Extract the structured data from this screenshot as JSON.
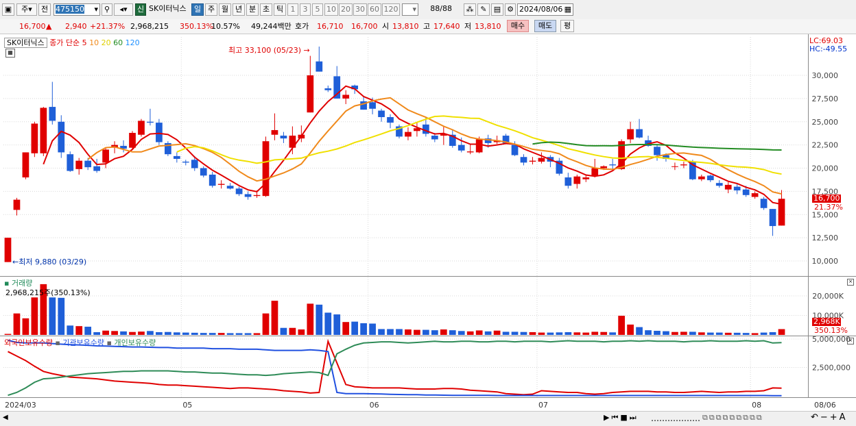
{
  "toolbar": {
    "period": "주",
    "jeon": "전",
    "code": "475150",
    "sin_badge": "신",
    "stock_name": "SK이터닉스",
    "tabs": [
      "일",
      "주",
      "월",
      "년",
      "분",
      "초",
      "틱"
    ],
    "selected_tab": "일",
    "intervals": [
      "1",
      "3",
      "5",
      "10",
      "20",
      "30",
      "60",
      "120"
    ],
    "page_count": "88/88",
    "date": "2024/08/06"
  },
  "quote": {
    "price": "16,700",
    "change": "2,940",
    "change_pct": "+21.37%",
    "volume": "2,968,215",
    "vol_ratio": "350.13%",
    "turnover": "10.57%",
    "amount": "49,244백만",
    "hoga_label": "호가",
    "hoga_1": "16,710",
    "hoga_2": "16,700",
    "open_label": "시",
    "open": "13,810",
    "high_label": "고",
    "high": "17,640",
    "low_label": "저",
    "low": "13,810",
    "buy_button": "매수",
    "sell_button": "매도",
    "eval_button": "평"
  },
  "price_panel": {
    "legend_name": "SK이터닉스",
    "legend_ma_label": "종가 단순",
    "ma_periods": [
      "5",
      "10",
      "20",
      "60",
      "120"
    ],
    "ma_colors": [
      "#e00000",
      "#f08a1c",
      "#f0e000",
      "#228b22",
      "#1e90ff"
    ],
    "lc": "LC:69.03",
    "hc": "HC:-49.55",
    "high_annotation": "최고 33,100 (05/23)",
    "low_annotation": "최저 9,880 (03/29)",
    "last_price_tag": "16,700",
    "last_pct_tag": "21.37%"
  },
  "volume_panel": {
    "title": "거래량",
    "value_text": "2,968,215주(350.13%)",
    "last_tag": "2,968K",
    "last_pct_tag": "350.13%"
  },
  "holdings_panel": {
    "legend": [
      "외국인보유수량",
      "기관보유수량",
      "개인보유수량"
    ],
    "colors": [
      "#e00000",
      "#2050e0",
      "#2e8b57"
    ]
  },
  "chart_data": [
    {
      "type": "candlestick",
      "title": "SK이터닉스",
      "y_ticks": [
        "10,000",
        "12,500",
        "15,000",
        "17,500",
        "20,000",
        "22,500",
        "25,000",
        "27,500",
        "30,000"
      ],
      "ylim": [
        8500,
        33500
      ],
      "x_labels": [
        "2024/03",
        "05",
        "06",
        "07",
        "08",
        "08/06"
      ],
      "ohlc": [
        [
          9880,
          12500,
          9880,
          12500
        ],
        [
          15500,
          16800,
          14900,
          16600
        ],
        [
          19000,
          21700,
          18800,
          21700
        ],
        [
          21600,
          25000,
          21200,
          24800
        ],
        [
          21600,
          26600,
          21300,
          26500
        ],
        [
          26600,
          29300,
          24700,
          25100
        ],
        [
          25000,
          25700,
          21100,
          21700
        ],
        [
          21500,
          21800,
          19600,
          19700
        ],
        [
          19900,
          21100,
          19300,
          20800
        ],
        [
          20800,
          21100,
          19800,
          20100
        ],
        [
          20200,
          21000,
          19500,
          19700
        ],
        [
          20600,
          22200,
          20000,
          22000
        ],
        [
          22200,
          22900,
          21600,
          22500
        ],
        [
          22400,
          23000,
          21700,
          22100
        ],
        [
          22200,
          24000,
          22000,
          23800
        ],
        [
          23600,
          25300,
          23400,
          25100
        ],
        [
          25000,
          26400,
          24600,
          24900
        ],
        [
          24900,
          25300,
          22500,
          22800
        ],
        [
          22700,
          22900,
          21300,
          21500
        ],
        [
          21300,
          21700,
          20600,
          21000
        ],
        [
          20700,
          20900,
          20300,
          20600
        ],
        [
          20900,
          21300,
          19700,
          20000
        ],
        [
          20000,
          20200,
          19000,
          19200
        ],
        [
          19300,
          19600,
          17900,
          18100
        ],
        [
          18200,
          18700,
          17800,
          18300
        ],
        [
          18100,
          18400,
          17700,
          17800
        ],
        [
          17800,
          18000,
          17000,
          17200
        ],
        [
          17200,
          17500,
          16600,
          16900
        ],
        [
          17000,
          17600,
          16800,
          17100
        ],
        [
          17000,
          23400,
          16900,
          22900
        ],
        [
          23600,
          25900,
          23000,
          24100
        ],
        [
          23500,
          23900,
          22700,
          23200
        ],
        [
          22200,
          24500,
          21500,
          23500
        ],
        [
          23200,
          24600,
          22800,
          23600
        ],
        [
          26000,
          32100,
          26000,
          30000
        ],
        [
          31500,
          33100,
          30400,
          30400
        ],
        [
          28600,
          28900,
          28200,
          28400
        ],
        [
          29900,
          31000,
          27500,
          27500
        ],
        [
          27500,
          28400,
          26900,
          27900
        ],
        [
          28900,
          29000,
          28000,
          28500
        ],
        [
          27200,
          27800,
          26300,
          26300
        ],
        [
          27100,
          27600,
          25800,
          26400
        ],
        [
          26200,
          26400,
          25000,
          25500
        ],
        [
          25500,
          25800,
          24300,
          24900
        ],
        [
          24500,
          24700,
          23200,
          23400
        ],
        [
          23400,
          24400,
          23000,
          23900
        ],
        [
          24000,
          24900,
          23400,
          24300
        ],
        [
          24700,
          25500,
          23400,
          23700
        ],
        [
          23500,
          23800,
          22800,
          23100
        ],
        [
          23500,
          24500,
          22500,
          23700
        ],
        [
          23600,
          24200,
          22200,
          22400
        ],
        [
          22500,
          23300,
          21700,
          21900
        ],
        [
          21700,
          22600,
          21500,
          21800
        ],
        [
          21700,
          23400,
          21600,
          23100
        ],
        [
          23200,
          23600,
          22200,
          22700
        ],
        [
          22800,
          23500,
          22600,
          23000
        ],
        [
          23500,
          23700,
          22600,
          22700
        ],
        [
          22500,
          22900,
          21300,
          21400
        ],
        [
          21200,
          21500,
          20300,
          20600
        ],
        [
          20700,
          21200,
          20400,
          20800
        ],
        [
          20700,
          21700,
          20500,
          21100
        ],
        [
          21200,
          21400,
          20100,
          20700
        ],
        [
          20800,
          21100,
          19200,
          19400
        ],
        [
          19000,
          19500,
          17800,
          18100
        ],
        [
          18300,
          19300,
          17800,
          19100
        ],
        [
          18800,
          19300,
          18500,
          19000
        ],
        [
          19200,
          21000,
          19000,
          20000
        ],
        [
          20000,
          20300,
          19800,
          20200
        ],
        [
          20400,
          21000,
          19800,
          20300
        ],
        [
          19900,
          23100,
          19800,
          22900
        ],
        [
          23100,
          25000,
          22700,
          24200
        ],
        [
          24200,
          25300,
          23200,
          23300
        ],
        [
          23000,
          23500,
          22300,
          22400
        ],
        [
          22300,
          22600,
          20800,
          21400
        ],
        [
          21400,
          21600,
          20700,
          21000
        ],
        [
          20200,
          20600,
          19800,
          20200
        ],
        [
          20300,
          20700,
          20000,
          20400
        ],
        [
          20700,
          20900,
          18700,
          18800
        ],
        [
          18800,
          19300,
          18600,
          19100
        ],
        [
          19200,
          19300,
          18500,
          18700
        ],
        [
          18400,
          18700,
          17900,
          18100
        ],
        [
          17700,
          18500,
          17300,
          18200
        ],
        [
          18000,
          18300,
          17200,
          17600
        ],
        [
          17700,
          18100,
          16900,
          17100
        ],
        [
          16900,
          17500,
          16700,
          17300
        ],
        [
          16700,
          16900,
          15500,
          15700
        ],
        [
          15600,
          15600,
          12700,
          13760
        ],
        [
          13810,
          17640,
          13810,
          16700
        ]
      ],
      "volume_k": [
        520,
        11000,
        8500,
        19200,
        26000,
        19200,
        19000,
        4800,
        4500,
        4200,
        1400,
        2200,
        2000,
        1800,
        1500,
        1700,
        2000,
        1400,
        1500,
        1300,
        1200,
        1100,
        1000,
        1000,
        1000,
        900,
        900,
        900,
        900,
        11000,
        17500,
        3600,
        3600,
        2800,
        16000,
        15500,
        11400,
        10500,
        6600,
        6800,
        6000,
        5800,
        3000,
        3000,
        3000,
        2800,
        2600,
        2600,
        2400,
        2800,
        2400,
        2000,
        1800,
        2300,
        1800,
        2200,
        1600,
        1600,
        1500,
        1400,
        1200,
        1200,
        1300,
        1400,
        1300,
        1200,
        1600,
        1500,
        1300,
        9800,
        5300,
        4000,
        2400,
        2100,
        1900,
        1500,
        1600,
        1600,
        1300,
        1200,
        1200,
        1100,
        1100,
        1000,
        900,
        1200,
        1400,
        2968
      ],
      "holdings": {
        "x_ticks": [
          "5,000,000",
          "2,500,000"
        ],
        "foreign": [
          3900000,
          3500000,
          3100000,
          2600000,
          2150000,
          1950000,
          1800000,
          1650000,
          1600000,
          1550000,
          1500000,
          1400000,
          1300000,
          1250000,
          1200000,
          1150000,
          1100000,
          1000000,
          950000,
          950000,
          900000,
          850000,
          800000,
          750000,
          700000,
          650000,
          700000,
          700000,
          650000,
          600000,
          550000,
          450000,
          400000,
          350000,
          250000,
          300000,
          4800000,
          2900000,
          1000000,
          800000,
          750000,
          700000,
          700000,
          700000,
          700000,
          650000,
          600000,
          600000,
          600000,
          650000,
          650000,
          600000,
          500000,
          450000,
          400000,
          350000,
          200000,
          150000,
          100000,
          150000,
          450000,
          400000,
          350000,
          300000,
          300000,
          200000,
          150000,
          200000,
          300000,
          350000,
          400000,
          400000,
          400000,
          350000,
          350000,
          300000,
          300000,
          350000,
          400000,
          350000,
          300000,
          350000,
          350000,
          400000,
          400000,
          450000,
          700000,
          680000
        ],
        "institution": [
          4900000,
          4700000,
          4650000,
          4650000,
          4650000,
          4600000,
          4550000,
          4500000,
          4480000,
          4450000,
          4400000,
          4380000,
          4350000,
          4330000,
          4300000,
          4300000,
          4280000,
          4250000,
          4250000,
          4200000,
          4200000,
          4200000,
          4200000,
          4150000,
          4150000,
          4150000,
          4100000,
          4100000,
          4100000,
          4050000,
          4000000,
          4000000,
          4000000,
          4000000,
          4050000,
          4000000,
          3900000,
          300000,
          200000,
          200000,
          200000,
          180000,
          160000,
          140000,
          120000,
          100000,
          100000,
          80000,
          80000,
          60000,
          50000,
          50000,
          50000,
          40000,
          40000,
          30000,
          30000,
          30000,
          30000,
          30000,
          30000,
          30000,
          30000,
          30000,
          30000,
          30000,
          30000,
          30000,
          30000,
          30000,
          30000,
          30000,
          30000,
          30000,
          30000,
          30000,
          30000,
          30000,
          30000,
          30000,
          30000,
          30000,
          30000,
          30000,
          30000,
          30000,
          20000,
          20000
        ],
        "individual": [
          50000,
          300000,
          700000,
          1200000,
          1500000,
          1550000,
          1650000,
          1750000,
          1850000,
          1950000,
          2000000,
          2050000,
          2100000,
          2150000,
          2150000,
          2200000,
          2200000,
          2200000,
          2200000,
          2150000,
          2100000,
          2100000,
          2050000,
          2000000,
          2000000,
          1950000,
          1900000,
          1850000,
          1850000,
          1800000,
          1850000,
          1950000,
          2000000,
          2050000,
          2100000,
          2050000,
          1800000,
          3700000,
          4100000,
          4450000,
          4650000,
          4700000,
          4750000,
          4750000,
          4700000,
          4650000,
          4700000,
          4750000,
          4800000,
          4750000,
          4750000,
          4800000,
          4800000,
          4750000,
          4750000,
          4800000,
          4800000,
          4750000,
          4800000,
          4800000,
          4800000,
          4750000,
          4800000,
          4850000,
          4800000,
          4800000,
          4800000,
          4750000,
          4800000,
          4800000,
          4850000,
          4800000,
          4850000,
          4800000,
          4800000,
          4800000,
          4750000,
          4800000,
          4800000,
          4850000,
          4800000,
          4800000,
          4800000,
          4850000,
          4800000,
          4850000,
          4650000,
          4680000
        ]
      }
    }
  ]
}
